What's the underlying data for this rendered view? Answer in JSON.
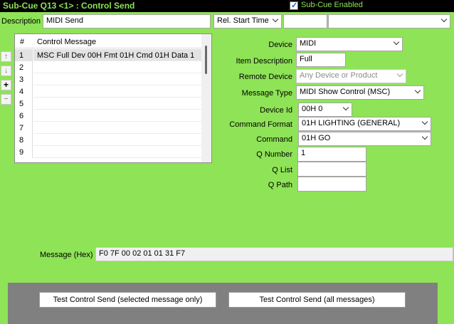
{
  "header": {
    "title": "Sub-Cue Q13 <1> : Control Send",
    "subcue_enabled_label": "Sub-Cue Enabled",
    "subcue_enabled": true
  },
  "top": {
    "description_label": "Description",
    "description_value": "MIDI Send",
    "rel_start_label": "Rel. Start Time",
    "rel_start_value": "",
    "extra_value": ""
  },
  "messages": {
    "headers": [
      "#",
      "Control Message"
    ],
    "rows": [
      {
        "num": "1",
        "message": "MSC Full  Dev 00H  Fmt 01H  Cmd 01H  Data 1"
      },
      {
        "num": "2",
        "message": ""
      },
      {
        "num": "3",
        "message": ""
      },
      {
        "num": "4",
        "message": ""
      },
      {
        "num": "5",
        "message": ""
      },
      {
        "num": "6",
        "message": ""
      },
      {
        "num": "7",
        "message": ""
      },
      {
        "num": "8",
        "message": ""
      },
      {
        "num": "9",
        "message": ""
      }
    ],
    "side_buttons": [
      "↑",
      "↓",
      "+",
      "−"
    ]
  },
  "form": {
    "device_label": "Device",
    "device_value": "MIDI",
    "item_desc_label": "Item Description",
    "item_desc_value": "Full",
    "remote_label": "Remote Device",
    "remote_value": "Any Device or Product",
    "msgtype_label": "Message Type",
    "msgtype_value": "MIDI Show Control (MSC)",
    "devid_label": "Device Id",
    "devid_value": "00H  0",
    "cmdfmt_label": "Command Format",
    "cmdfmt_value": "01H  LIGHTING (GENERAL)",
    "cmd_label": "Command",
    "cmd_value": "01H  GO",
    "qnum_label": "Q Number",
    "qnum_value": "1",
    "qlist_label": "Q List",
    "qlist_value": "",
    "qpath_label": "Q Path",
    "qpath_value": ""
  },
  "hex": {
    "label": "Message (Hex)",
    "value": "F0 7F 00 02 01 01 31 F7"
  },
  "footer": {
    "test_selected_label": "Test Control Send (selected message only)",
    "test_all_label": "Test Control Send (all messages)"
  }
}
